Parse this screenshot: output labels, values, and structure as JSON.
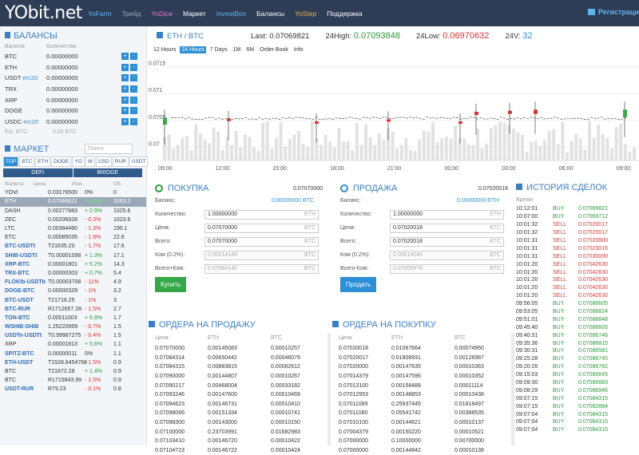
{
  "nav": {
    "logo": "YObit.net",
    "items": [
      {
        "label": "YoFarm",
        "color": "#5fb3f0"
      },
      {
        "label": "Трейд",
        "color": "#9aa8b8"
      },
      {
        "label": "YoDice",
        "color": "#e879d8"
      },
      {
        "label": "Маркет",
        "color": "#ffffff"
      },
      {
        "label": "InvestBox",
        "color": "#5fb3f0"
      },
      {
        "label": "Балансы",
        "color": "#ffffff"
      },
      {
        "label": "YoStep",
        "color": "#f0b23c"
      },
      {
        "label": "Поддержка",
        "color": "#ffffff"
      }
    ],
    "register": "Регистраци"
  },
  "balances": {
    "title": "БАЛАНСЫ",
    "col_currency": "Валюта",
    "col_amount": "Количество",
    "rows": [
      {
        "cur": "BTC",
        "tag": "",
        "val": "0.00000000"
      },
      {
        "cur": "ETH",
        "tag": "",
        "val": "0.00000000"
      },
      {
        "cur": "USDT",
        "tag": "erc20",
        "val": "0.00000000"
      },
      {
        "cur": "TRX",
        "tag": "",
        "val": "0.00000000"
      },
      {
        "cur": "XRP",
        "tag": "",
        "val": "0.00000000"
      },
      {
        "cur": "DOGE",
        "tag": "",
        "val": "0.00000000"
      },
      {
        "cur": "USDC",
        "tag": "erc20",
        "val": "0.00000000"
      }
    ],
    "est_label": "Est. BTC:",
    "est_value": "0.00 BTC",
    "plus": "+",
    "minus": "-"
  },
  "market": {
    "title": "МАРКЕТ",
    "search_placeholder": "Поиск",
    "tabs": [
      "TOP",
      "BTC",
      "ETH",
      "DOGE",
      "YO",
      "W",
      "USD",
      "RUR",
      "USDT"
    ],
    "subtabs": [
      "DEFI",
      "BRIDGE"
    ],
    "cols": [
      "Валюта",
      "Цена",
      "Изм.",
      "Об."
    ],
    "rows": [
      {
        "n": "YOVI",
        "p": "0.03176500",
        "c": "0%",
        "v": "0",
        "bold": false,
        "dir": ""
      },
      {
        "n": "ETH",
        "p": "0.07069821",
        "c": "+ 0.5%",
        "v": "3263.2",
        "bold": false,
        "dir": "up",
        "sel": true
      },
      {
        "n": "DASH",
        "p": "0.00277883",
        "c": "+ 0.9%",
        "v": "1025.6",
        "bold": false,
        "dir": "up"
      },
      {
        "n": "ZEC",
        "p": "0.00206928",
        "c": "- 0.3%",
        "v": "1023.6",
        "bold": false,
        "dir": "dn"
      },
      {
        "n": "LTC",
        "p": "0.00384460",
        "c": "- 1.3%",
        "v": "190.1",
        "bold": false,
        "dir": "dn"
      },
      {
        "n": "ETC",
        "p": "0.00085035",
        "c": "- 1.9%",
        "v": "22.6",
        "bold": false,
        "dir": "dn"
      },
      {
        "n": "BTC-USDTt",
        "p": "T21635.20",
        "c": "- 1.7%",
        "v": "17.6",
        "bold": true,
        "dir": "dn"
      },
      {
        "n": "SHIB-USDTt",
        "p": "T0.00001098",
        "c": "+ 1.3%",
        "v": "17.1",
        "bold": true,
        "dir": "up"
      },
      {
        "n": "XRP-BTC",
        "p": "0.00001801",
        "c": "+ 5.2%",
        "v": "14.3",
        "bold": true,
        "dir": "up"
      },
      {
        "n": "TRX-BTC",
        "p": "0.00000303",
        "c": "+ 0.7%",
        "v": "5.4",
        "bold": true,
        "dir": "up"
      },
      {
        "n": "FLOKIb-USDTb",
        "p": "T0.00003708",
        "c": "- 11%",
        "v": "4.9",
        "bold": true,
        "dir": "dn"
      },
      {
        "n": "DOGE-BTC",
        "p": "0.00000329",
        "c": "- 1%",
        "v": "3.2",
        "bold": true,
        "dir": "dn"
      },
      {
        "n": "BTC-USDT",
        "p": "T21716.25",
        "c": "- 1%",
        "v": "3",
        "bold": true,
        "dir": "dn"
      },
      {
        "n": "BTC-RUR",
        "p": "R1712657.28",
        "c": "- 1.5%",
        "v": "2.7",
        "bold": true,
        "dir": "dn"
      },
      {
        "n": "TON-BTC",
        "p": "0.00011003",
        "c": "+ 6.9%",
        "v": "1.7",
        "bold": true,
        "dir": "up"
      },
      {
        "n": "WSHIB-SHIB",
        "p": "1.25220959",
        "c": "- 0.7%",
        "v": "1.5",
        "bold": true,
        "dir": "dn"
      },
      {
        "n": "USDTe-USDTt",
        "p": "T0.99987275",
        "c": "- 0.4%",
        "v": "1.5",
        "bold": true,
        "dir": "dn"
      },
      {
        "n": "XRP",
        "p": "0.00001813",
        "c": "+ 5.6%",
        "v": "1.1",
        "bold": false,
        "dir": "up"
      },
      {
        "n": "SPITZ-BTC",
        "p": "0.00000011",
        "c": "0%",
        "v": "1.1",
        "bold": true,
        "dir": ""
      },
      {
        "n": "ETH-USDT",
        "p": "T1528.6454768",
        "c": "- 1.5%",
        "v": "0.9",
        "bold": true,
        "dir": "dn"
      },
      {
        "n": "BTC",
        "p": "T21872.28",
        "c": "+ 1.4%",
        "v": "0.9",
        "bold": false,
        "dir": "up"
      },
      {
        "n": "BTC",
        "p": "R1715843.99",
        "c": "- 1.5%",
        "v": "0.9",
        "bold": false,
        "dir": "dn"
      },
      {
        "n": "USDT-RUR",
        "p": "R79.23",
        "c": "- 0.1%",
        "v": "0.8",
        "bold": true,
        "dir": "dn"
      }
    ]
  },
  "pair": {
    "title": "ETH / BTC",
    "last_label": "Last:",
    "last": "0.07069821",
    "high_label": "24High:",
    "high": "0.07093848",
    "low_label": "24Low:",
    "low": "0.06970632",
    "vol_label": "24V:",
    "vol": "32"
  },
  "chart_tabs": [
    "12 Hours",
    "24 Hours",
    "7 Days",
    "1M",
    "6M",
    "Order Book",
    "Info"
  ],
  "chart_data": {
    "type": "candlestick",
    "y_ticks": [
      "0.0715",
      "0.071",
      "0.0705",
      "0.07"
    ],
    "ylim": [
      0.0699,
      0.0716
    ],
    "x_ticks": [
      "09:00",
      "12:00",
      "15:00",
      "18:00",
      "21:00",
      "00:00",
      "03:00",
      "06:00",
      "09:00"
    ]
  },
  "buy": {
    "title": "ПОКУПКА",
    "price": "0.07070000",
    "balance_label": "Баланс:",
    "balance": "0.00000000 BTC",
    "qty_label": "Количество:",
    "qty": "1.00000000",
    "qty_cur": "ETH",
    "price_label": "Цена:",
    "price_val": "0.07070000",
    "price_cur": "BTC",
    "total_label": "Всего:",
    "total": "0.07070000",
    "total_cur": "BTC",
    "fee_label": "Ком (0.2%):",
    "fee": "0.00014140",
    "fee_cur": "BTC",
    "sum_label": "Всего+Ком:",
    "sum": "0.07084140",
    "sum_cur": "BTC",
    "button": "Купить"
  },
  "sell": {
    "title": "ПРОДАЖА",
    "price": "0.07020018",
    "balance_label": "Баланс:",
    "balance": "0.00000000 ETH",
    "qty_label": "Количество:",
    "qty": "1.00000000",
    "qty_cur": "ETH",
    "price_label": "Цена:",
    "price_val": "0.07020018",
    "price_cur": "BTC",
    "total_label": "Всего:",
    "total": "0.07020018",
    "total_cur": "BTC",
    "fee_label": "Ком (0.2%):",
    "fee": "0.00014040",
    "fee_cur": "BTC",
    "sum_label": "Всего-Ком:",
    "sum": "0.07005978",
    "sum_cur": "BTC",
    "button": "Продать"
  },
  "sell_orders": {
    "title": "ОРДЕРА НА ПРОДАЖУ",
    "cols": [
      "Цена",
      "ETH",
      "BTC"
    ],
    "rows": [
      [
        "0.07070000",
        "0.00145083",
        "0.00010257"
      ],
      [
        "0.07084314",
        "0.00650442",
        "0.00046079"
      ],
      [
        "0.07084315",
        "0.00883815",
        "0.00062612"
      ],
      [
        "0.07090000",
        "0.00144807",
        "0.00010267"
      ],
      [
        "0.07090217",
        "0.00468004",
        "0.00033182"
      ],
      [
        "0.07093246",
        "0.00147600",
        "0.00010469"
      ],
      [
        "0.07094623",
        "0.00146731",
        "0.00010410"
      ],
      [
        "0.07098066",
        "0.00151334",
        "0.00010741"
      ],
      [
        "0.07098300",
        "0.00143000",
        "0.00010150"
      ],
      [
        "0.07100000",
        "0.23703991",
        "0.01682983"
      ],
      [
        "0.07103410",
        "0.00146720",
        "0.00010422"
      ],
      [
        "0.07104723",
        "0.00146722",
        "0.00010424"
      ]
    ]
  },
  "buy_orders": {
    "title": "ОРДЕРА НА ПОКУПКУ",
    "cols": [
      "Цена",
      "ETH",
      "BTC"
    ],
    "rows": [
      [
        "0.07020018",
        "0.01067664",
        "0.00074950"
      ],
      [
        "0.07020017",
        "0.01808931",
        "0.00126987"
      ],
      [
        "0.07020000",
        "0.00147635",
        "0.00010363"
      ],
      [
        "0.07014379",
        "0.00147596",
        "0.00010352"
      ],
      [
        "0.07013100",
        "0.00158489",
        "0.00011114"
      ],
      [
        "0.07012953",
        "0.00148853",
        "0.00010438"
      ],
      [
        "0.07011089",
        "0.25937445",
        "0.01818497"
      ],
      [
        "0.07011080",
        "0.05541742",
        "0.00388535"
      ],
      [
        "0.07010100",
        "0.00144621",
        "0.00010137"
      ],
      [
        "0.07004379",
        "0.00150220",
        "0.00010521"
      ],
      [
        "0.07000000",
        "0.10000000",
        "0.00700000"
      ],
      [
        "0.07000000",
        "0.00144842",
        "0.00010138"
      ]
    ]
  },
  "history": {
    "title": "ИСТОРИЯ СДЕЛОК",
    "cols": [
      "Время",
      "",
      ""
    ],
    "rows": [
      [
        "10:12:01",
        "BUY",
        "0.07069821"
      ],
      [
        "10:07:00",
        "BUY",
        "0.07069712"
      ],
      [
        "10:01:32",
        "SELL",
        "0.07020017"
      ],
      [
        "10:01:32",
        "SELL",
        "0.07020017"
      ],
      [
        "10:01:31",
        "SELL",
        "0.07020800"
      ],
      [
        "10:01:31",
        "SELL",
        "0.07023016"
      ],
      [
        "10:01:31",
        "SELL",
        "0.07030000"
      ],
      [
        "10:01:20",
        "SELL",
        "0.07042630"
      ],
      [
        "10:01:20",
        "SELL",
        "0.07042630"
      ],
      [
        "10:01:20",
        "SELL",
        "0.07042630"
      ],
      [
        "10:01:20",
        "SELL",
        "0.07042630"
      ],
      [
        "10:01:20",
        "SELL",
        "0.07042630"
      ],
      [
        "09:56:05",
        "BUY",
        "0.07086605"
      ],
      [
        "09:53:05",
        "BUY",
        "0.07086824"
      ],
      [
        "09:51:01",
        "BUY",
        "0.07086848"
      ],
      [
        "09:45:40",
        "BUY",
        "0.07086605"
      ],
      [
        "09:40:31",
        "BUY",
        "0.07086746"
      ],
      [
        "09:35:36",
        "BUY",
        "0.07086815"
      ],
      [
        "09:30:31",
        "BUY",
        "0.07086581"
      ],
      [
        "09:25:28",
        "BUY",
        "0.07086745"
      ],
      [
        "09:20:26",
        "BUY",
        "0.07086782"
      ],
      [
        "09:15:03",
        "BUY",
        "0.07086845"
      ],
      [
        "09:09:30",
        "BUY",
        "0.07086883"
      ],
      [
        "09:08:29",
        "BUY",
        "0.07086946"
      ],
      [
        "09:07:15",
        "BUY",
        "0.07084315"
      ],
      [
        "09:07:15",
        "BUY",
        "0.07082884"
      ],
      [
        "09:07:04",
        "BUY",
        "0.07084315"
      ],
      [
        "09:07:04",
        "BUY",
        "0.07084315"
      ],
      [
        "09:07:04",
        "BUY",
        "0.07084315"
      ]
    ]
  },
  "colors": {
    "accent": "#3a7fc4",
    "up": "#2a9a3a",
    "down": "#d33333",
    "topbar": "#2e3d55"
  }
}
